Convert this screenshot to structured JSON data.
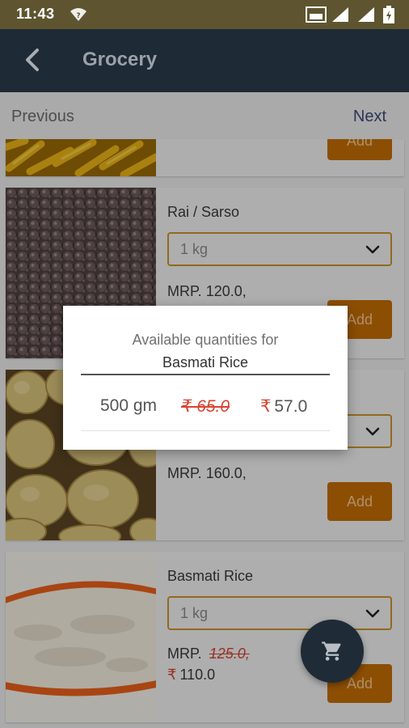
{
  "status_bar": {
    "time": "11:43",
    "icons": [
      "wifi-question-icon",
      "volte-icon",
      "signal-icon",
      "signal-icon",
      "battery-icon"
    ]
  },
  "app_bar": {
    "title": "Grocery",
    "back_icon": "arrow-back-icon"
  },
  "pager": {
    "previous_label": "Previous",
    "next_label": "Next"
  },
  "products": [
    {
      "name": "",
      "add_label": "Add"
    },
    {
      "name": "Rai / Sarso",
      "quantity": "1 kg",
      "mrp_label": "MRP.",
      "mrp": "120.0,",
      "add_label": "Add"
    },
    {
      "name": "",
      "mrp_label": "MRP.",
      "mrp": "160.0,",
      "add_label": "Add"
    },
    {
      "name": "Basmati Rice",
      "quantity": "1 kg",
      "mrp_label": "MRP.",
      "mrp_struck": "125.0,",
      "currency": "₹",
      "price": "110.0",
      "add_label": "Add"
    }
  ],
  "dialog": {
    "heading": "Available quantities for",
    "product": "Basmati Rice",
    "options": [
      {
        "quantity": "500 gm",
        "old_price": "₹ 65.0",
        "currency": "₹",
        "price": "57.0"
      }
    ]
  },
  "fab": {
    "icon": "cart-icon"
  },
  "colors": {
    "status_bar": "#5e5530",
    "app_bar": "#1e2a35",
    "accent": "#c26d05",
    "strike_red": "#d64531",
    "select_border": "#c9942a"
  }
}
